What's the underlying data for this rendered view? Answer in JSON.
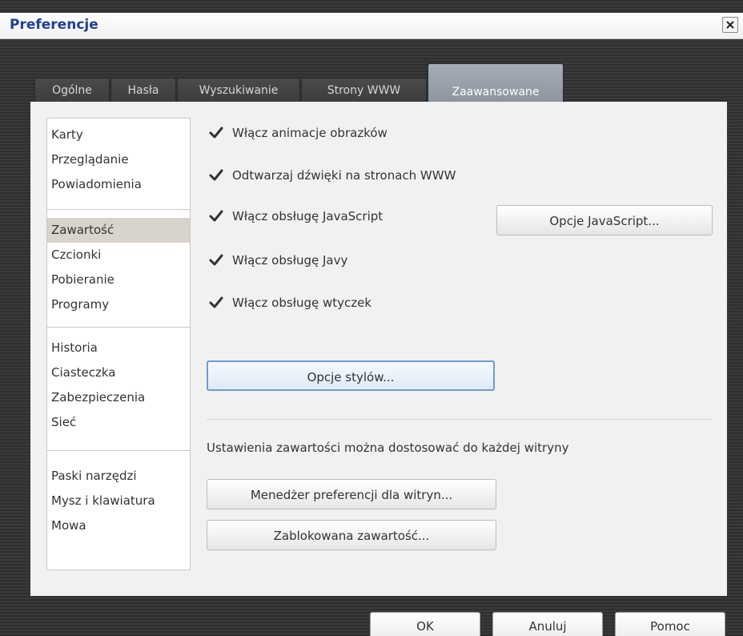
{
  "window": {
    "title": "Preferencje",
    "close_symbol": "×",
    "title_color": "#1f3f97"
  },
  "tabs": [
    {
      "label": "Ogólne",
      "active": false
    },
    {
      "label": "Hasła",
      "active": false
    },
    {
      "label": "Wyszukiwanie",
      "active": false
    },
    {
      "label": "Strony WWW",
      "active": false
    },
    {
      "label": "Zaawansowane",
      "active": true
    }
  ],
  "sidebar": {
    "groups": [
      {
        "items": [
          "Karty",
          "Przeglądanie",
          "Powiadomienia"
        ]
      },
      {
        "items": [
          "Zawartość",
          "Czcionki",
          "Pobieranie",
          "Programy"
        ],
        "selected": "Zawartość"
      },
      {
        "items": [
          "Historia",
          "Ciasteczka",
          "Zabezpieczenia",
          "Sieć"
        ]
      },
      {
        "items": [
          "Paski narzędzi",
          "Mysz i klawiatura",
          "Mowa"
        ]
      }
    ]
  },
  "content": {
    "checkboxes": [
      {
        "label": "Włącz animacje obrazków",
        "checked": true
      },
      {
        "label": "Odtwarzaj dźwięki na stronach WWW",
        "checked": true
      },
      {
        "label": "Włącz obsługę JavaScript",
        "checked": true
      },
      {
        "label": "Włącz obsługę Javy",
        "checked": true
      },
      {
        "label": "Włącz obsługę wtyczek",
        "checked": true
      }
    ],
    "javascript_options_label": "Opcje JavaScript...",
    "style_options_label": "Opcje stylów...",
    "site_settings_text": "Ustawienia zawartości można dostosować do każdej witryny",
    "site_manager_label": "Menedżer preferencji dla witryn...",
    "blocked_content_label": "Zablokowana zawartość..."
  },
  "footer": {
    "ok_label": "OK",
    "cancel_label": "Anuluj",
    "help_label": "Pomoc"
  },
  "icons": {
    "checkmark": "checkmark-icon",
    "close": "close-icon"
  },
  "colors": {
    "focus_border": "#6e9cd3",
    "selected_item": "#d9d4cb",
    "active_tab": "#9aa1aa"
  }
}
